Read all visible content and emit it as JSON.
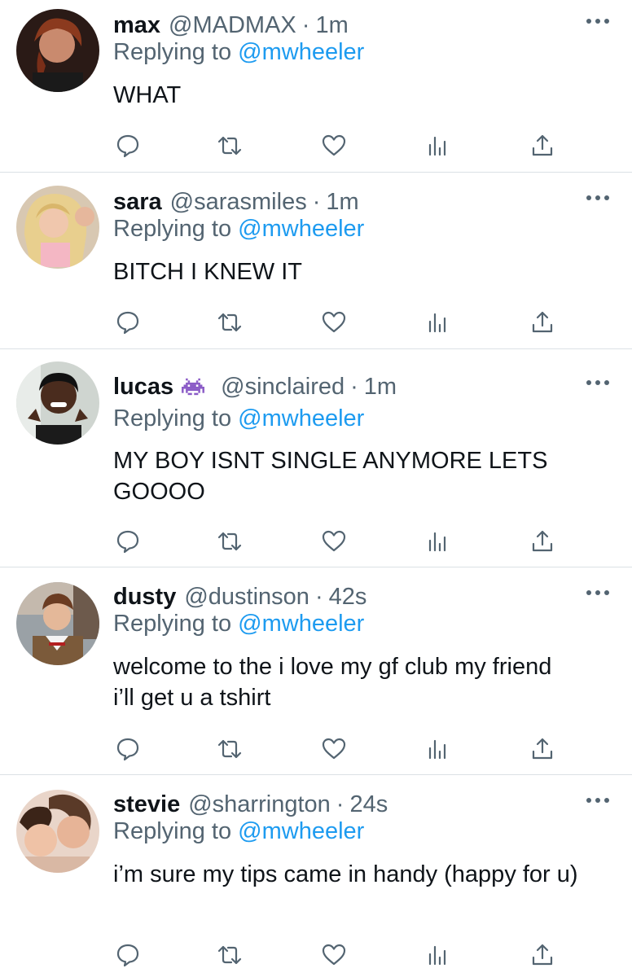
{
  "colors": {
    "accent": "#1d9bf0",
    "muted": "#536471",
    "text": "#0f1419",
    "divider": "#dbe1e5"
  },
  "reply_prefix": "Replying to",
  "tweets": [
    {
      "name": "max",
      "handle": "@MADMAX",
      "separator": "·",
      "time": "1m",
      "replying_to": "@mwheeler",
      "text": "WHAT",
      "badge_icon": null
    },
    {
      "name": "sara",
      "handle": "@sarasmiles",
      "separator": "·",
      "time": "1m",
      "replying_to": "@mwheeler",
      "text": "BITCH I KNEW IT",
      "badge_icon": null
    },
    {
      "name": "lucas",
      "handle": "@sinclaired",
      "separator": "·",
      "time": "1m",
      "replying_to": "@mwheeler",
      "text": "MY BOY ISNT SINGLE ANYMORE LETS GOOOO",
      "badge_icon": "space-invader-emoji-icon"
    },
    {
      "name": "dusty",
      "handle": "@dustinson",
      "separator": "·",
      "time": "42s",
      "replying_to": "@mwheeler",
      "text": "welcome to the i love my gf club my friend i’ll get u a tshirt",
      "badge_icon": null
    },
    {
      "name": "stevie",
      "handle": "@sharrington",
      "separator": "·",
      "time": "24s",
      "replying_to": "@mwheeler",
      "text": "i’m sure my tips came in handy (happy for u)",
      "badge_icon": null
    }
  ],
  "action_icons": [
    "reply-icon",
    "retweet-icon",
    "like-icon",
    "analytics-icon",
    "share-icon"
  ],
  "more_icon": "more-options-icon"
}
